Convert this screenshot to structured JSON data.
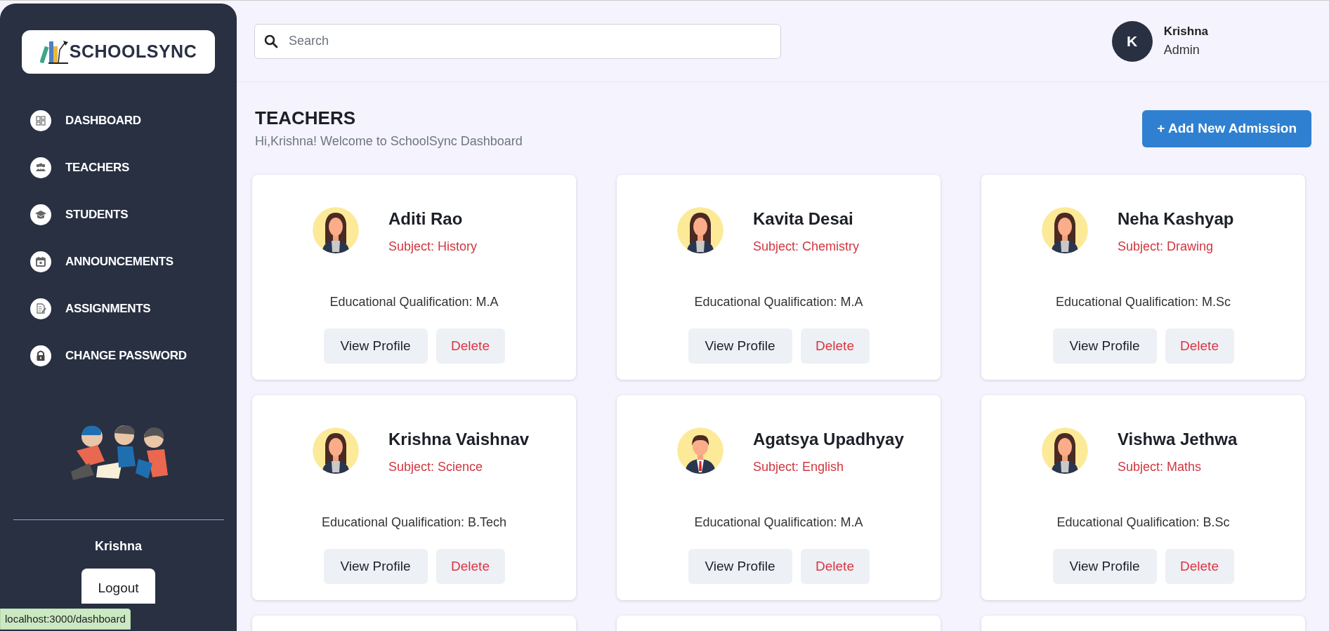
{
  "sidebar": {
    "logo": "SCHOOLSYNC",
    "items": [
      {
        "label": "DASHBOARD"
      },
      {
        "label": "TEACHERS"
      },
      {
        "label": "STUDENTS"
      },
      {
        "label": "ANNOUNCEMENTS"
      },
      {
        "label": "ASSIGNMENTS"
      },
      {
        "label": "CHANGE PASSWORD"
      }
    ],
    "user_name": "Krishna",
    "logout": "Logout"
  },
  "header": {
    "search": {
      "placeholder": "Search"
    },
    "user": {
      "initial": "K",
      "name": "Krishna",
      "role": "Admin"
    }
  },
  "page": {
    "title": "TEACHERS",
    "subtitle": "Hi,Krishna! Welcome to SchoolSync Dashboard",
    "add_button": "+ Add New Admission"
  },
  "teachers": [
    {
      "kind": "female",
      "name": "Aditi Rao",
      "subject": "Subject: History",
      "qualification": "Educational Qualification: M.A",
      "view": "View Profile",
      "delete": "Delete"
    },
    {
      "kind": "female",
      "name": "Kavita Desai",
      "subject": "Subject: Chemistry",
      "qualification": "Educational Qualification: M.A",
      "view": "View Profile",
      "delete": "Delete"
    },
    {
      "kind": "female",
      "name": "Neha Kashyap",
      "subject": "Subject: Drawing",
      "qualification": "Educational Qualification: M.Sc",
      "view": "View Profile",
      "delete": "Delete"
    },
    {
      "kind": "female",
      "name": "Krishna Vaishnav",
      "subject": "Subject: Science",
      "qualification": "Educational Qualification: B.Tech",
      "view": "View Profile",
      "delete": "Delete"
    },
    {
      "kind": "male",
      "name": "Agatsya Upadhyay",
      "subject": "Subject: English",
      "qualification": "Educational Qualification: M.A",
      "view": "View Profile",
      "delete": "Delete"
    },
    {
      "kind": "female",
      "name": "Vishwa Jethwa",
      "subject": "Subject: Maths",
      "qualification": "Educational Qualification: B.Sc",
      "view": "View Profile",
      "delete": "Delete"
    }
  ],
  "status_url": "localhost:3000/dashboard"
}
